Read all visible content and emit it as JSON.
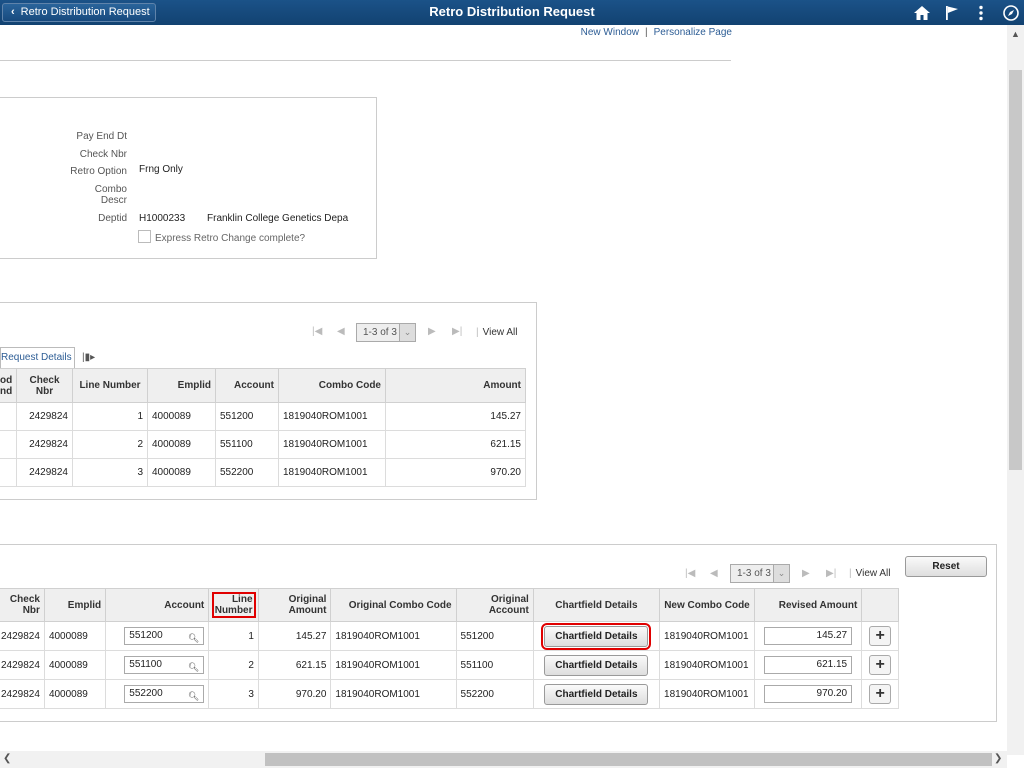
{
  "header": {
    "back_label": "Retro Distribution Request",
    "title": "Retro Distribution Request",
    "icons": [
      "home-icon",
      "flag-icon",
      "more-icon",
      "compass-icon"
    ]
  },
  "top_links": {
    "new_window": "New Window",
    "personalize": "Personalize Page",
    "separator": "|"
  },
  "info": {
    "pay_end_dt_label": "Pay End Dt",
    "check_nbr_label": "Check Nbr",
    "retro_option_label": "Retro Option",
    "retro_option_value": "Frng Only",
    "combo_descr_label_1": "Combo",
    "combo_descr_label_2": "Descr",
    "deptid_label": "Deptid",
    "deptid_value": "H1000233",
    "deptid_descr": "Franklin College Genetics Depa",
    "express_label": "Express Retro Change complete?"
  },
  "grid1": {
    "pager": "1-3 of 3",
    "view_all": "View All",
    "tab_label": "Request Details",
    "headers": [
      "od\nnd",
      "Check Nbr",
      "Line Number",
      "Emplid",
      "Account",
      "Combo Code",
      "Amount"
    ],
    "rows": [
      {
        "check": "2429824",
        "line": "1",
        "emplid": "4000089",
        "account": "551200",
        "combo": "1819040ROM1001",
        "amount": "145.27"
      },
      {
        "check": "2429824",
        "line": "2",
        "emplid": "4000089",
        "account": "551100",
        "combo": "1819040ROM1001",
        "amount": "621.15"
      },
      {
        "check": "2429824",
        "line": "3",
        "emplid": "4000089",
        "account": "552200",
        "combo": "1819040ROM1001",
        "amount": "970.20"
      }
    ]
  },
  "grid2": {
    "pager": "1-3 of 3",
    "view_all": "View All",
    "reset_label": "Reset",
    "headers": {
      "check_1": "Check",
      "check_2": "Nbr",
      "emplid": "Emplid",
      "account": "Account",
      "line_1": "Line",
      "line_2": "Number",
      "orig_amt_1": "Original",
      "orig_amt_2": "Amount",
      "orig_combo": "Original Combo Code",
      "orig_acct_1": "Original",
      "orig_acct_2": "Account",
      "chartfield": "Chartfield Details",
      "new_combo": "New Combo Code",
      "revised": "Revised Amount"
    },
    "button_label": "Chartfield Details",
    "rows": [
      {
        "check": "2429824",
        "emplid": "4000089",
        "account": "551200",
        "line": "1",
        "orig_amount": "145.27",
        "orig_combo": "1819040ROM1001",
        "orig_account": "551200",
        "new_combo": "1819040ROM1001",
        "revised": "145.27"
      },
      {
        "check": "2429824",
        "emplid": "4000089",
        "account": "551100",
        "line": "2",
        "orig_amount": "621.15",
        "orig_combo": "1819040ROM1001",
        "orig_account": "551100",
        "new_combo": "1819040ROM1001",
        "revised": "621.15"
      },
      {
        "check": "2429824",
        "emplid": "4000089",
        "account": "552200",
        "line": "3",
        "orig_amount": "970.20",
        "orig_combo": "1819040ROM1001",
        "orig_account": "552200",
        "new_combo": "1819040ROM1001",
        "revised": "970.20"
      }
    ]
  },
  "colors": {
    "header_bg": "#1b5288",
    "link": "#2d5d95",
    "highlight": "#e00000"
  }
}
